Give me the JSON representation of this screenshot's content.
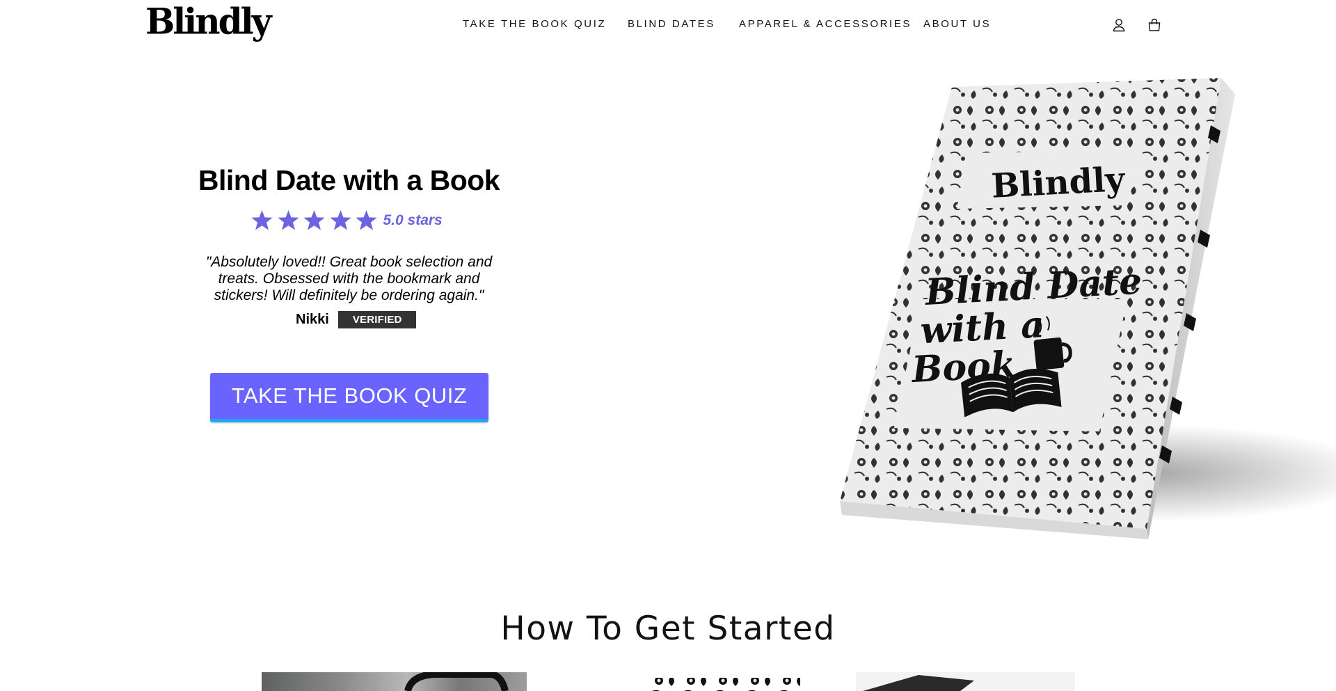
{
  "header": {
    "logo_text": "Blindly",
    "nav": [
      {
        "label": "TAKE THE BOOK QUIZ"
      },
      {
        "label": "BLIND DATES"
      },
      {
        "label": "APPAREL & ACCESSORIES"
      },
      {
        "label": "ABOUT US"
      }
    ],
    "icons": [
      "account-icon",
      "cart-icon"
    ]
  },
  "hero": {
    "title": "Blind Date with a Book",
    "rating": 5,
    "rating_text": "5.0 stars",
    "quote": "\"Absolutely loved!! Great book selection and treats. Obsessed with the bookmark and stickers! Will definitely be ordering again.\"",
    "reviewer": "Nikki",
    "badge": "VERIFIED",
    "cta_label": "TAKE THE BOOK QUIZ",
    "book_brand": "Blindly",
    "book_title_lines": [
      "Blind Date",
      "with a",
      "Book"
    ]
  },
  "section": {
    "title": "How To Get Started"
  },
  "colors": {
    "accent": "#6b63ff",
    "accent_underline": "#1da8ef",
    "star": "#6c63e0",
    "badge_bg": "#333333"
  }
}
